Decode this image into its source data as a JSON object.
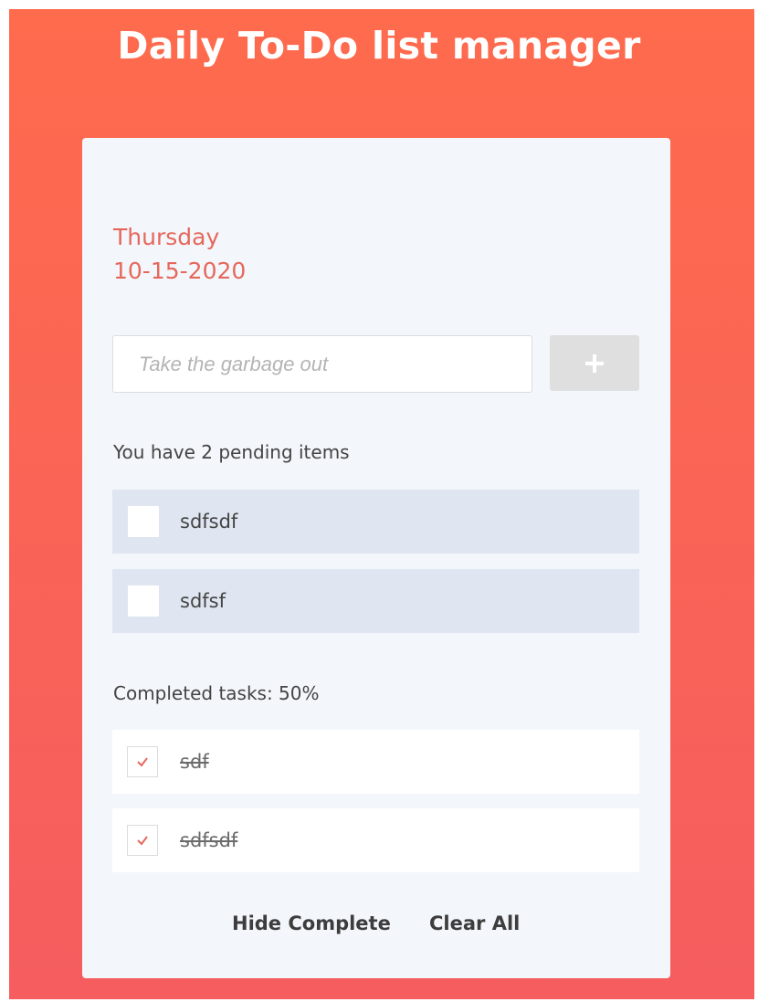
{
  "header": {
    "title": "Daily To-Do list manager"
  },
  "date": {
    "day": "Thursday",
    "date": "10-15-2020"
  },
  "input": {
    "placeholder": "Take the garbage out",
    "add_icon": "plus-icon"
  },
  "pending": {
    "summary": "You have 2 pending items",
    "items": [
      {
        "label": "sdfsdf",
        "checked": false
      },
      {
        "label": "sdfsf",
        "checked": false
      }
    ]
  },
  "completed": {
    "summary": "Completed tasks: 50%",
    "items": [
      {
        "label": "sdf",
        "checked": true
      },
      {
        "label": "sdfsdf",
        "checked": true
      }
    ]
  },
  "footer": {
    "hide_label": "Hide Complete",
    "clear_label": "Clear All"
  },
  "colors": {
    "gradient_top": "#fe6b4d",
    "gradient_bottom": "#f55d5f",
    "date_accent": "#e5685d",
    "check_accent": "#e5685d"
  }
}
